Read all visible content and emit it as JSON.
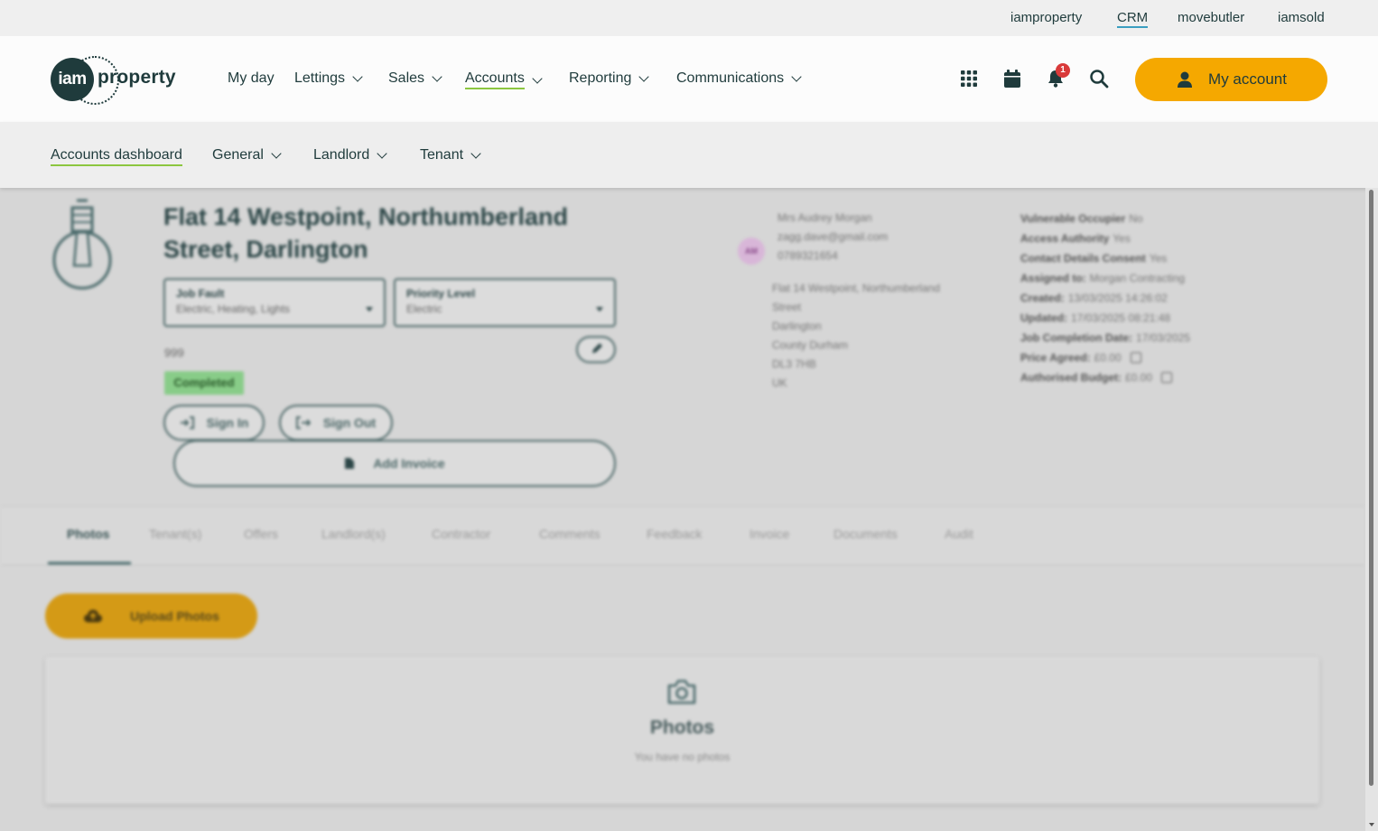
{
  "utility": {
    "links": [
      "iamproperty",
      "CRM",
      "movebutler",
      "iamsold"
    ]
  },
  "brand": {
    "logo_mark": "iam",
    "logo_word": "property"
  },
  "nav": {
    "items": [
      {
        "label": "My day"
      },
      {
        "label": "Lettings"
      },
      {
        "label": "Sales"
      },
      {
        "label": "Accounts"
      },
      {
        "label": "Reporting"
      },
      {
        "label": "Communications"
      }
    ],
    "active": "Accounts"
  },
  "header_icons": [
    "apps-grid-icon",
    "calendar-icon",
    "bell-icon",
    "search-icon"
  ],
  "notification_count": "1",
  "account_button": {
    "label": "My account"
  },
  "sub_nav": {
    "items": [
      {
        "label": "Accounts dashboard"
      },
      {
        "label": "General"
      },
      {
        "label": "Landlord"
      },
      {
        "label": "Tenant"
      }
    ]
  },
  "job": {
    "title_line1": "Flat 14 Westpoint, Northumberland",
    "title_line2": "Street, Darlington",
    "fault": {
      "label": "Job Fault",
      "value": "Electric, Heating, Lights"
    },
    "priority": {
      "label": "Priority Level",
      "value": "Electric"
    },
    "reference": "999",
    "status": "Completed",
    "sign_in": "Sign In",
    "sign_out": "Sign Out",
    "add_invoice": "Add Invoice"
  },
  "tenant": {
    "initials": "AM",
    "name": "Mrs Audrey Morgan",
    "email": "zagg.dave@gmail.com",
    "phone": "0789321654",
    "address": [
      "Flat 14 Westpoint, Northumberland",
      "Street",
      "Darlington",
      "County Durham",
      "DL3 7HB",
      "UK"
    ]
  },
  "meta": [
    {
      "label": "Vulnerable Occupier",
      "value": "No"
    },
    {
      "label": "Access Authority",
      "value": "Yes"
    },
    {
      "label": "Contact Details Consent",
      "value": "Yes"
    },
    {
      "label": "Assigned to:",
      "value": "Morgan Contracting"
    },
    {
      "label": "Created:",
      "value": "13/03/2025 14:26:02"
    },
    {
      "label": "Updated:",
      "value": "17/03/2025 08:21:48"
    },
    {
      "label": "Job Completion Date:",
      "value": "17/03/2025"
    },
    {
      "label": "Price Agreed:",
      "value": "£0.00"
    },
    {
      "label": "Authorised Budget:",
      "value": "£0.00"
    }
  ],
  "tabs": [
    "Photos",
    "Tenant(s)",
    "Offers",
    "Landlord(s)",
    "Contractor",
    "Comments",
    "Feedback",
    "Invoice",
    "Documents",
    "Audit"
  ],
  "active_tab": "Photos",
  "photos": {
    "upload_label": "Upload Photos",
    "title": "Photos",
    "empty_text": "You have no photos"
  },
  "colors": {
    "brand_dark": "#1f3b3c",
    "accent_orange": "#f5a800",
    "active_underline": "#8cc63f",
    "crm_underline": "#3b9ec0",
    "badge_red": "#d93a3a",
    "status_green": "#88cc88"
  }
}
